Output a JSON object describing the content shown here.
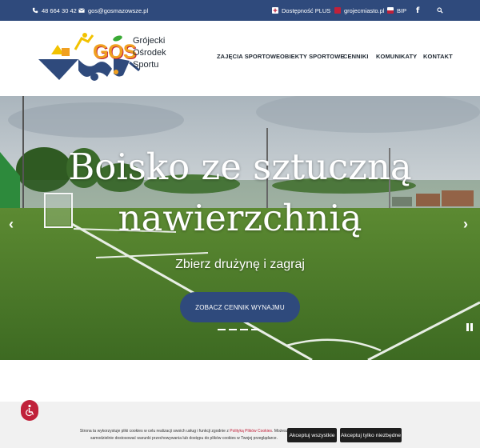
{
  "topbar": {
    "phone": "48 664 30 42",
    "email": "gos@gosmazowsze.pl",
    "accessibility": "Dostępność PLUS",
    "city_link": "grojecmiasto.pl",
    "bip": "BIP"
  },
  "logo": {
    "wordmark": "GOS",
    "line1": "Grójecki",
    "line2": "Ośrodek",
    "line3": "Sportu"
  },
  "nav": {
    "items": [
      "ZAJĘCIA SPORTOWE",
      "OBIEKTY SPORTOWE",
      "CENNIKI",
      "KOMUNIKATY",
      "KONTAKT"
    ]
  },
  "hero": {
    "title_line1": "Boisko ze sztuczną",
    "title_line2": "nawierzchnią",
    "subtitle": "Zbierz drużynę i zagraj",
    "button": "ZOBACZ CENNIK WYNAJMU",
    "prev_arrow": "‹",
    "next_arrow": "›"
  },
  "cookie": {
    "text_before": "Strona ta wykorzystuje pliki cookies w celu realizacji swoich usług i funkcji zgodnie z ",
    "link": "Polityką Plików Cookies",
    "text_after": ". Możesz samodzielnie dostosować warunki przechowywania lub dostępu do plików cookies w Twojej przeglądarce.",
    "accept_all": "Akceptuj wszystkie",
    "accept_required": "Akceptuj tylko niezbędne"
  },
  "colors": {
    "brand_blue": "#2f4a7c",
    "accent_red": "#c0213a",
    "logo_orange": "#f0a020",
    "logo_yellow": "#f2c200",
    "logo_green": "#3aaa35"
  }
}
